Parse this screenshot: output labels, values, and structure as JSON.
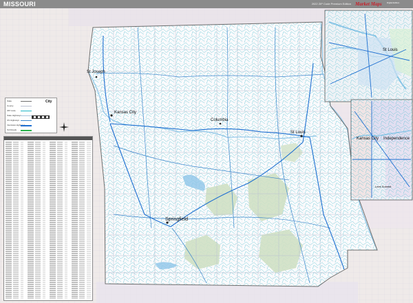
{
  "header": {
    "title": "MISSOURI",
    "edition": "2022 ZIP Code Premium Edition",
    "logo_text": "Market Maps",
    "logo_side": "Digital Edition"
  },
  "main_map": {
    "cities": [
      {
        "name": "St Joseph"
      },
      {
        "name": "Kansas City"
      },
      {
        "name": "Columbia"
      },
      {
        "name": "St Louis"
      },
      {
        "name": "Springfield"
      }
    ]
  },
  "insets": [
    {
      "name": "st-louis-inset",
      "label": "St Louis"
    },
    {
      "name": "kansas-city-inset",
      "labels": [
        "Kansas City",
        "Independence",
        "Lees Summit"
      ]
    }
  ],
  "legend": {
    "rows": [
      {
        "label": "State"
      },
      {
        "label": "County"
      },
      {
        "label": "ZIP Code"
      },
      {
        "label": "State Highways"
      },
      {
        "label": "US Highways"
      },
      {
        "label": "Interstate Highways"
      },
      {
        "label": "Toll Roads"
      }
    ],
    "city_label": "City"
  },
  "colors": {
    "interstate": "#1d6fd1",
    "us_highway": "#3b86cc",
    "local_road": "#a9c3dd",
    "zip_line": "#1eb7c7",
    "county": "#b8bfd0",
    "state_border": "#6d6d6d",
    "forest": "#cfe0c4",
    "neighbor_state": "#e7e2ea",
    "water": "#8fc6e8"
  }
}
